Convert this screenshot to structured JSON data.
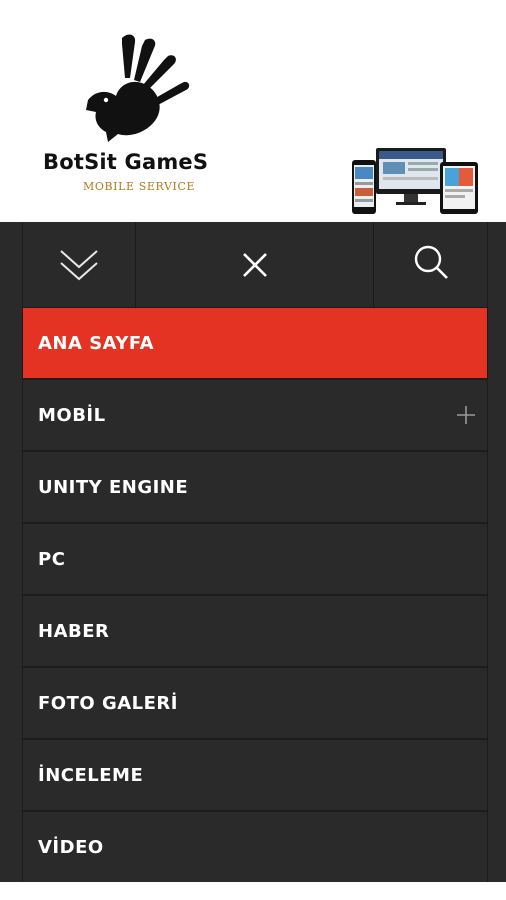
{
  "brand": {
    "name": "BotSit GameS",
    "subtitle": "MOBILE SERVICE",
    "accent_color": "#e53323",
    "subtitle_color": "#b07a1e"
  },
  "toolbar": {
    "icons": [
      "chevron-double-down-icon",
      "close-icon",
      "search-icon"
    ]
  },
  "menu": {
    "items": [
      {
        "label": "ANA SAYFA",
        "active": true
      },
      {
        "label": "MOBİL",
        "has_children": true
      },
      {
        "label": "UNITY ENGINE"
      },
      {
        "label": "PC"
      },
      {
        "label": "HABER"
      },
      {
        "label": "FOTO GALERİ"
      },
      {
        "label": "İNCELEME"
      },
      {
        "label": "VİDEO"
      }
    ]
  }
}
